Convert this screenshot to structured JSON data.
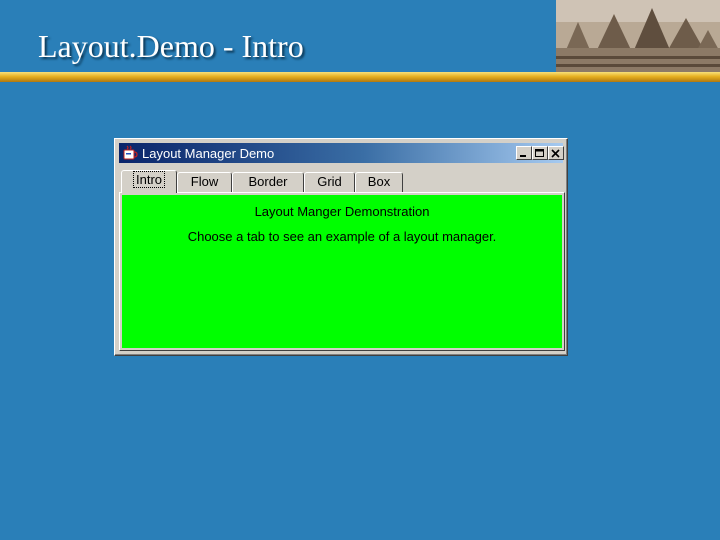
{
  "slide": {
    "title": "Layout.Demo - Intro"
  },
  "window": {
    "title": "Layout Manager Demo",
    "controls": [
      "minimize",
      "maximize",
      "close"
    ]
  },
  "tabs": [
    {
      "label": "Intro",
      "selected": true
    },
    {
      "label": "Flow",
      "selected": false
    },
    {
      "label": "Border",
      "selected": false
    },
    {
      "label": "Grid",
      "selected": false
    },
    {
      "label": "Box",
      "selected": false
    }
  ],
  "panel": {
    "background": "#00ff00",
    "heading": "Layout Manger Demonstration",
    "message": "Choose a tab to see an example of a layout manager."
  },
  "colors": {
    "slide_background": "#2a7fb8",
    "title_rule": "#e6b020",
    "window_title_bar": "#0a246a"
  },
  "icons": [
    "java-app-icon",
    "minimize-icon",
    "maximize-icon",
    "close-icon"
  ]
}
